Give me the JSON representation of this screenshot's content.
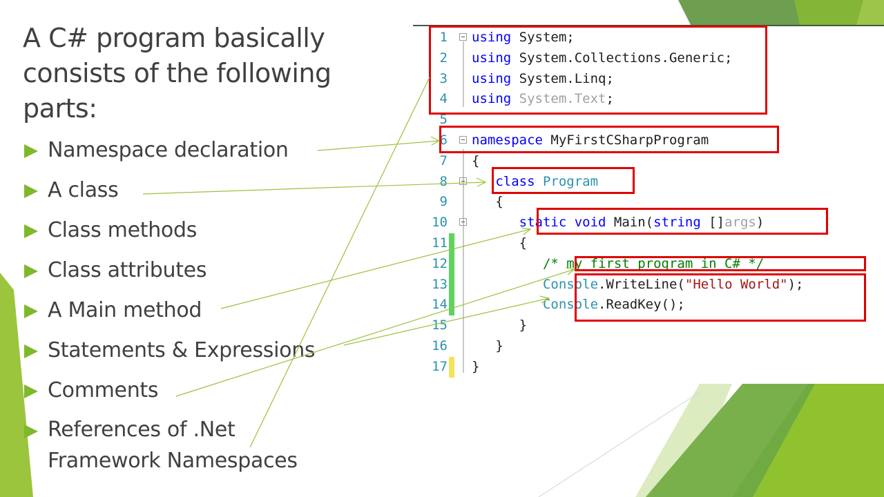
{
  "slide": {
    "title": "A C# program basically consists of the following parts:",
    "bullets": [
      {
        "label": "Namespace declaration"
      },
      {
        "label": "A class"
      },
      {
        "label": "Class methods"
      },
      {
        "label": "Class attributes"
      },
      {
        "label": "A Main method"
      },
      {
        "label": "Statements & Expressions"
      },
      {
        "label": "Comments"
      },
      {
        "label": "References of .Net Framework Namespaces"
      }
    ],
    "colors": {
      "accent_green": "#7fb82a",
      "highlight_red": "#e00000",
      "text_gray": "#404040"
    }
  },
  "code": {
    "language": "C#",
    "lines": [
      {
        "n": "1",
        "tokens": [
          [
            "kw",
            "using"
          ],
          [
            "",
            "System;"
          ]
        ]
      },
      {
        "n": "2",
        "tokens": [
          [
            "kw",
            "using"
          ],
          [
            "",
            "System.Collections.Generic;"
          ]
        ]
      },
      {
        "n": "3",
        "tokens": [
          [
            "kw",
            "using"
          ],
          [
            "",
            "System.Linq;"
          ]
        ]
      },
      {
        "n": "4",
        "tokens": [
          [
            "kw",
            "using"
          ],
          [
            "gr",
            "System.Text"
          ],
          [
            "",
            ";"
          ]
        ]
      },
      {
        "n": "5",
        "tokens": []
      },
      {
        "n": "6",
        "tokens": [
          [
            "kw",
            "namespace"
          ],
          [
            "",
            "MyFirstCSharpProgram"
          ]
        ]
      },
      {
        "n": "7",
        "tokens": [
          [
            "",
            "{"
          ]
        ]
      },
      {
        "n": "8",
        "tokens": [
          [
            "",
            "   "
          ],
          [
            "kw",
            "class"
          ],
          [
            "ty",
            "Program"
          ]
        ]
      },
      {
        "n": "9",
        "tokens": [
          [
            "",
            "   {"
          ]
        ]
      },
      {
        "n": "10",
        "tokens": [
          [
            "",
            "      "
          ],
          [
            "kw",
            "static"
          ],
          [
            "kw",
            "void"
          ],
          [
            "",
            "Main("
          ],
          [
            "kw",
            "string"
          ],
          [
            "",
            "[]"
          ],
          [
            "gr",
            "args"
          ],
          [
            "",
            ")"
          ]
        ]
      },
      {
        "n": "11",
        "tokens": [
          [
            "",
            "      {"
          ]
        ]
      },
      {
        "n": "12",
        "tokens": [
          [
            "",
            "         "
          ],
          [
            "cm",
            "/* my first program in C# */"
          ]
        ]
      },
      {
        "n": "13",
        "tokens": [
          [
            "",
            "         "
          ],
          [
            "ty",
            "Console"
          ],
          [
            "",
            ".WriteLine("
          ],
          [
            "st",
            "\"Hello World\""
          ],
          [
            "",
            ");"
          ]
        ]
      },
      {
        "n": "14",
        "tokens": [
          [
            "",
            "         "
          ],
          [
            "ty",
            "Console"
          ],
          [
            "",
            ".ReadKey();"
          ]
        ]
      },
      {
        "n": "15",
        "tokens": [
          [
            "",
            "      }"
          ]
        ]
      },
      {
        "n": "16",
        "tokens": [
          [
            "",
            "   }"
          ]
        ]
      },
      {
        "n": "17",
        "tokens": [
          [
            "",
            "}"
          ]
        ]
      }
    ],
    "change_markers": {
      "11": "#5fd35f",
      "12": "#5fd35f",
      "13": "#5fd35f",
      "14": "#5fd35f",
      "17": "#f5e25a"
    },
    "fold_lines": [
      "1",
      "6",
      "8",
      "10"
    ]
  }
}
